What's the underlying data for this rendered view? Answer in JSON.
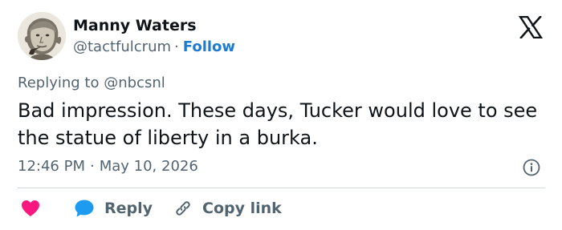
{
  "author": {
    "name": "Manny Waters",
    "handle": "@tactfulcrum",
    "separator": "·",
    "follow_label": "Follow"
  },
  "replying": {
    "prefix": "Replying to",
    "mention": "@nbcsnl"
  },
  "tweet": {
    "text": "Bad impression. These days, Tucker would love to see the statue of liberty in a burka.",
    "time": "12:46 PM",
    "separator": "·",
    "date": "May 10, 2026"
  },
  "actions": {
    "reply_label": "Reply",
    "copy_link_label": "Copy link"
  },
  "icons": {
    "brand": "x-logo-icon",
    "info": "info-icon",
    "like": "heart-icon",
    "reply": "reply-bubble-icon",
    "copy": "link-icon"
  },
  "colors": {
    "text_primary": "#0f1419",
    "text_secondary": "#536471",
    "follow": "#1d7bd1",
    "heart": "#f91880",
    "reply_bubble": "#1d9bf0",
    "divider": "#cfd9de"
  }
}
